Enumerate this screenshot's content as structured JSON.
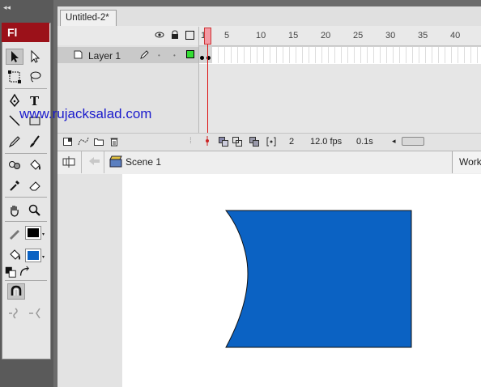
{
  "app": {
    "logo": "Fl",
    "collapse_glyph": "◂◂"
  },
  "document": {
    "tab_title": "Untitled-2*"
  },
  "timeline": {
    "ruler_numbers": [
      "1",
      "5",
      "10",
      "15",
      "20",
      "25",
      "30",
      "35",
      "40"
    ],
    "layers": [
      {
        "name": "Layer 1"
      }
    ],
    "footer": {
      "current_frame": "2",
      "frame_rate": "12.0 fps",
      "elapsed_time": "0.1s"
    }
  },
  "edit_bar": {
    "scene_name": "Scene 1",
    "workspace_label": "Work"
  },
  "watermark": "www.rujacksalad.com",
  "colors": {
    "shape_fill": "#0b62c3",
    "stroke_swatch": "#000000",
    "fill_swatch": "#0b62c3",
    "logo_bg": "#9b1119",
    "playhead": "#dd1111"
  }
}
